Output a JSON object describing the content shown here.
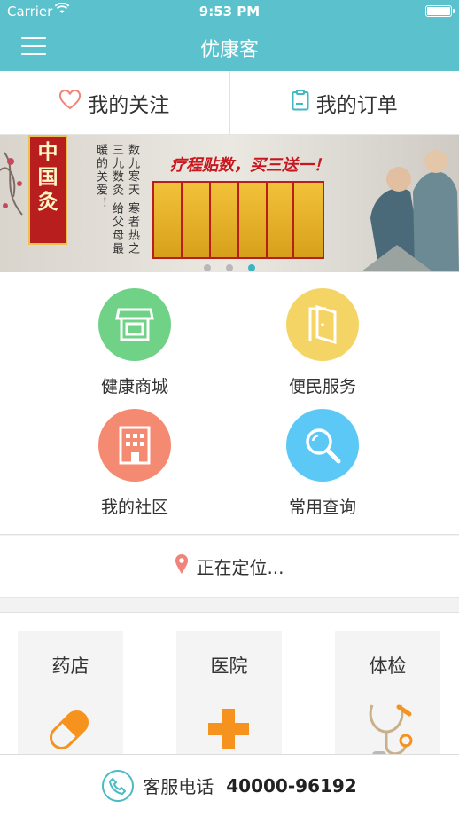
{
  "status_bar": {
    "carrier": "Carrier",
    "time": "9:53 PM"
  },
  "nav": {
    "title": "优康客"
  },
  "quick_tabs": [
    {
      "label": "我的关注",
      "icon": "heart-icon"
    },
    {
      "label": "我的订单",
      "icon": "clipboard-icon"
    }
  ],
  "banner": {
    "stamp": "中国灸",
    "poem": "数九寒天 寒者热之 三九数灸 给父母最 暖的关爱！",
    "slogan": "疗程贴数，买三送一！",
    "active_slide": 3,
    "slide_count": 3
  },
  "services": [
    {
      "label": "健康商城",
      "icon": "store-icon",
      "color": "#6fd286"
    },
    {
      "label": "便民服务",
      "icon": "door-icon",
      "color": "#f5d466"
    },
    {
      "label": "我的社区",
      "icon": "building-icon",
      "color": "#f58a72"
    },
    {
      "label": "常用查询",
      "icon": "magnifier-icon",
      "color": "#5cc8f5"
    }
  ],
  "location": {
    "text": "正在定位..."
  },
  "categories": [
    {
      "label": "药店",
      "icon": "pill-icon"
    },
    {
      "label": "医院",
      "icon": "cross-icon"
    },
    {
      "label": "体检",
      "icon": "stethoscope-icon"
    }
  ],
  "footer": {
    "label": "客服电话",
    "number": "40000-96192"
  },
  "colors": {
    "theme": "#5bc2cd",
    "accent_orange": "#f5931e"
  }
}
